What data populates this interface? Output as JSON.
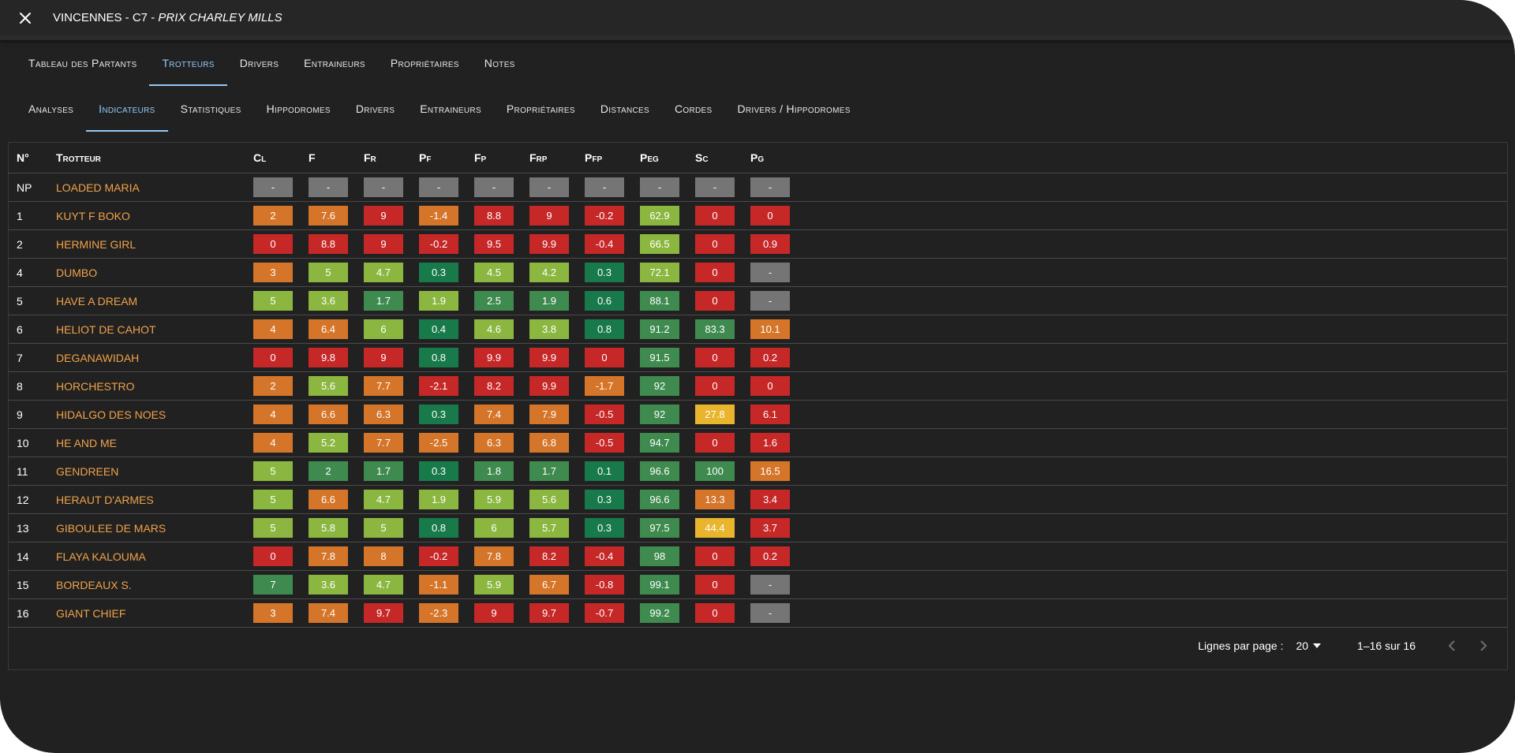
{
  "header": {
    "title_main": "VINCENNES - C7 - ",
    "title_race": "PRIX CHARLEY MILLS"
  },
  "main_tabs": [
    {
      "label": "Tableau des Partants",
      "active": false
    },
    {
      "label": "Trotteurs",
      "active": true
    },
    {
      "label": "Drivers",
      "active": false
    },
    {
      "label": "Entraineurs",
      "active": false
    },
    {
      "label": "Propriétaires",
      "active": false
    },
    {
      "label": "Notes",
      "active": false
    }
  ],
  "sub_tabs": [
    {
      "label": "Analyses",
      "active": false
    },
    {
      "label": "Indicateurs",
      "active": true
    },
    {
      "label": "Statistiques",
      "active": false
    },
    {
      "label": "Hippodromes",
      "active": false
    },
    {
      "label": "Drivers",
      "active": false
    },
    {
      "label": "Entraineurs",
      "active": false
    },
    {
      "label": "Propriétaires",
      "active": false
    },
    {
      "label": "Distances",
      "active": false
    },
    {
      "label": "Cordes",
      "active": false
    },
    {
      "label": "Drivers / Hippodromes",
      "active": false
    }
  ],
  "table": {
    "columns": [
      "N°",
      "Trotteur",
      "Cl",
      "F",
      "Fr",
      "Pf",
      "Fp",
      "Frp",
      "Pfp",
      "Peg",
      "Sc",
      "Pg"
    ],
    "palette": {
      "gray": "#757575",
      "red": "#c62828",
      "orange": "#d4752a",
      "yellow": "#e8b52c",
      "lime": "#8bb741",
      "green": "#3f8a4f",
      "darkgreen": "#187a4a"
    },
    "rows": [
      {
        "num": "NP",
        "name": "LOADED MARIA",
        "values": [
          "-",
          "-",
          "-",
          "-",
          "-",
          "-",
          "-",
          "-",
          "-",
          "-"
        ],
        "colors": [
          "gray",
          "gray",
          "gray",
          "gray",
          "gray",
          "gray",
          "gray",
          "gray",
          "gray",
          "gray"
        ]
      },
      {
        "num": "1",
        "name": "KUYT F BOKO",
        "values": [
          "2",
          "7.6",
          "9",
          "-1.4",
          "8.8",
          "9",
          "-0.2",
          "62.9",
          "0",
          "0"
        ],
        "colors": [
          "orange",
          "orange",
          "red",
          "orange",
          "red",
          "red",
          "red",
          "lime",
          "red",
          "red"
        ]
      },
      {
        "num": "2",
        "name": "HERMINE GIRL",
        "values": [
          "0",
          "8.8",
          "9",
          "-0.2",
          "9.5",
          "9.9",
          "-0.4",
          "66.5",
          "0",
          "0.9"
        ],
        "colors": [
          "red",
          "red",
          "red",
          "red",
          "red",
          "red",
          "red",
          "lime",
          "red",
          "red"
        ]
      },
      {
        "num": "4",
        "name": "DUMBO",
        "values": [
          "3",
          "5",
          "4.7",
          "0.3",
          "4.5",
          "4.2",
          "0.3",
          "72.1",
          "0",
          "-"
        ],
        "colors": [
          "orange",
          "lime",
          "lime",
          "darkgreen",
          "lime",
          "lime",
          "darkgreen",
          "lime",
          "red",
          "gray"
        ]
      },
      {
        "num": "5",
        "name": "HAVE A DREAM",
        "values": [
          "5",
          "3.6",
          "1.7",
          "1.9",
          "2.5",
          "1.9",
          "0.6",
          "88.1",
          "0",
          "-"
        ],
        "colors": [
          "lime",
          "lime",
          "green",
          "lime",
          "green",
          "green",
          "darkgreen",
          "green",
          "red",
          "gray"
        ]
      },
      {
        "num": "6",
        "name": "HELIOT DE CAHOT",
        "values": [
          "4",
          "6.4",
          "6",
          "0.4",
          "4.6",
          "3.8",
          "0.8",
          "91.2",
          "83.3",
          "10.1"
        ],
        "colors": [
          "orange",
          "orange",
          "lime",
          "darkgreen",
          "lime",
          "lime",
          "darkgreen",
          "green",
          "green",
          "orange"
        ]
      },
      {
        "num": "7",
        "name": "DEGANAWIDAH",
        "values": [
          "0",
          "9.8",
          "9",
          "0.8",
          "9.9",
          "9.9",
          "0",
          "91.5",
          "0",
          "0.2"
        ],
        "colors": [
          "red",
          "red",
          "red",
          "darkgreen",
          "red",
          "red",
          "red",
          "green",
          "red",
          "red"
        ]
      },
      {
        "num": "8",
        "name": "HORCHESTRO",
        "values": [
          "2",
          "5.6",
          "7.7",
          "-2.1",
          "8.2",
          "9.9",
          "-1.7",
          "92",
          "0",
          "0"
        ],
        "colors": [
          "orange",
          "lime",
          "orange",
          "red",
          "red",
          "red",
          "orange",
          "green",
          "red",
          "red"
        ]
      },
      {
        "num": "9",
        "name": "HIDALGO DES NOES",
        "values": [
          "4",
          "6.6",
          "6.3",
          "0.3",
          "7.4",
          "7.9",
          "-0.5",
          "92",
          "27.8",
          "6.1"
        ],
        "colors": [
          "orange",
          "orange",
          "orange",
          "darkgreen",
          "orange",
          "orange",
          "red",
          "green",
          "yellow",
          "red"
        ]
      },
      {
        "num": "10",
        "name": "HE AND ME",
        "values": [
          "4",
          "5.2",
          "7.7",
          "-2.5",
          "6.3",
          "6.8",
          "-0.5",
          "94.7",
          "0",
          "1.6"
        ],
        "colors": [
          "orange",
          "lime",
          "orange",
          "orange",
          "orange",
          "orange",
          "red",
          "green",
          "red",
          "red"
        ]
      },
      {
        "num": "11",
        "name": "GENDREEN",
        "values": [
          "5",
          "2",
          "1.7",
          "0.3",
          "1.8",
          "1.7",
          "0.1",
          "96.6",
          "100",
          "16.5"
        ],
        "colors": [
          "lime",
          "green",
          "green",
          "darkgreen",
          "green",
          "green",
          "darkgreen",
          "green",
          "green",
          "orange"
        ]
      },
      {
        "num": "12",
        "name": "HERAUT D'ARMES",
        "values": [
          "5",
          "6.6",
          "4.7",
          "1.9",
          "5.9",
          "5.6",
          "0.3",
          "96.6",
          "13.3",
          "3.4"
        ],
        "colors": [
          "lime",
          "orange",
          "lime",
          "lime",
          "lime",
          "lime",
          "darkgreen",
          "green",
          "orange",
          "red"
        ]
      },
      {
        "num": "13",
        "name": "GIBOULEE DE MARS",
        "values": [
          "5",
          "5.8",
          "5",
          "0.8",
          "6",
          "5.7",
          "0.3",
          "97.5",
          "44.4",
          "3.7"
        ],
        "colors": [
          "lime",
          "lime",
          "lime",
          "darkgreen",
          "lime",
          "lime",
          "darkgreen",
          "green",
          "yellow",
          "red"
        ]
      },
      {
        "num": "14",
        "name": "FLAYA KALOUMA",
        "values": [
          "0",
          "7.8",
          "8",
          "-0.2",
          "7.8",
          "8.2",
          "-0.4",
          "98",
          "0",
          "0.2"
        ],
        "colors": [
          "red",
          "orange",
          "orange",
          "red",
          "orange",
          "red",
          "red",
          "green",
          "red",
          "red"
        ]
      },
      {
        "num": "15",
        "name": "BORDEAUX S.",
        "values": [
          "7",
          "3.6",
          "4.7",
          "-1.1",
          "5.9",
          "6.7",
          "-0.8",
          "99.1",
          "0",
          "-"
        ],
        "colors": [
          "green",
          "lime",
          "lime",
          "orange",
          "lime",
          "orange",
          "red",
          "green",
          "red",
          "gray"
        ]
      },
      {
        "num": "16",
        "name": "GIANT CHIEF",
        "values": [
          "3",
          "7.4",
          "9.7",
          "-2.3",
          "9",
          "9.7",
          "-0.7",
          "99.2",
          "0",
          "-"
        ],
        "colors": [
          "orange",
          "orange",
          "red",
          "orange",
          "red",
          "red",
          "red",
          "green",
          "red",
          "gray"
        ]
      }
    ]
  },
  "footer": {
    "rows_per_page_label": "Lignes par page :",
    "rows_per_page_value": "20",
    "range": "1–16 sur 16"
  },
  "icons": {
    "close": "close-icon",
    "dropdown": "caret-down-icon",
    "prev": "chevron-left-icon",
    "next": "chevron-right-icon"
  }
}
